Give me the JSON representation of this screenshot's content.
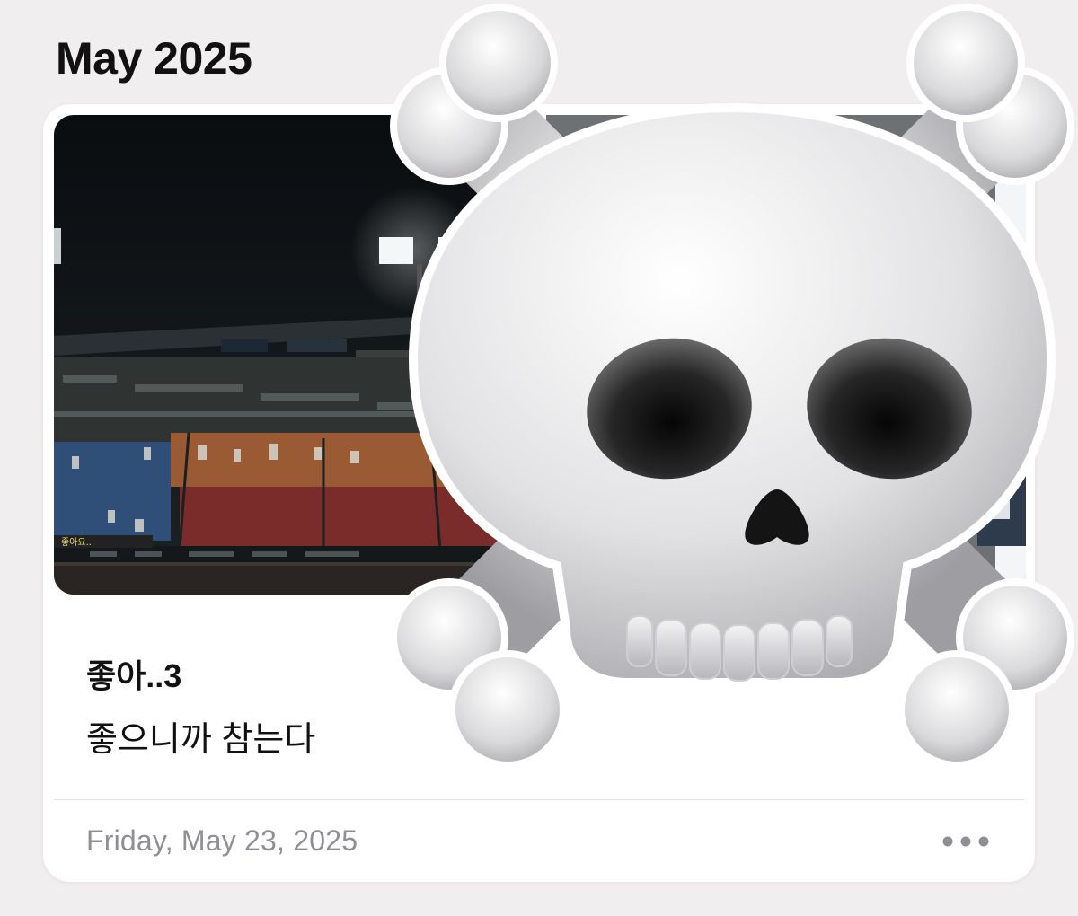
{
  "header": {
    "month": "May 2025"
  },
  "entry": {
    "title": "좋아..3",
    "body": "좋으니까 참는다",
    "date": "Friday, May 23, 2025",
    "more_icon": "ellipsis-icon"
  },
  "sticker": {
    "icon": "skull-and-crossbones-icon"
  },
  "photo_main": {
    "banner_text": "좋아요..."
  },
  "colors": {
    "background": "#f1eeef",
    "card": "#ffffff",
    "secondary_text": "#8e8e93"
  }
}
